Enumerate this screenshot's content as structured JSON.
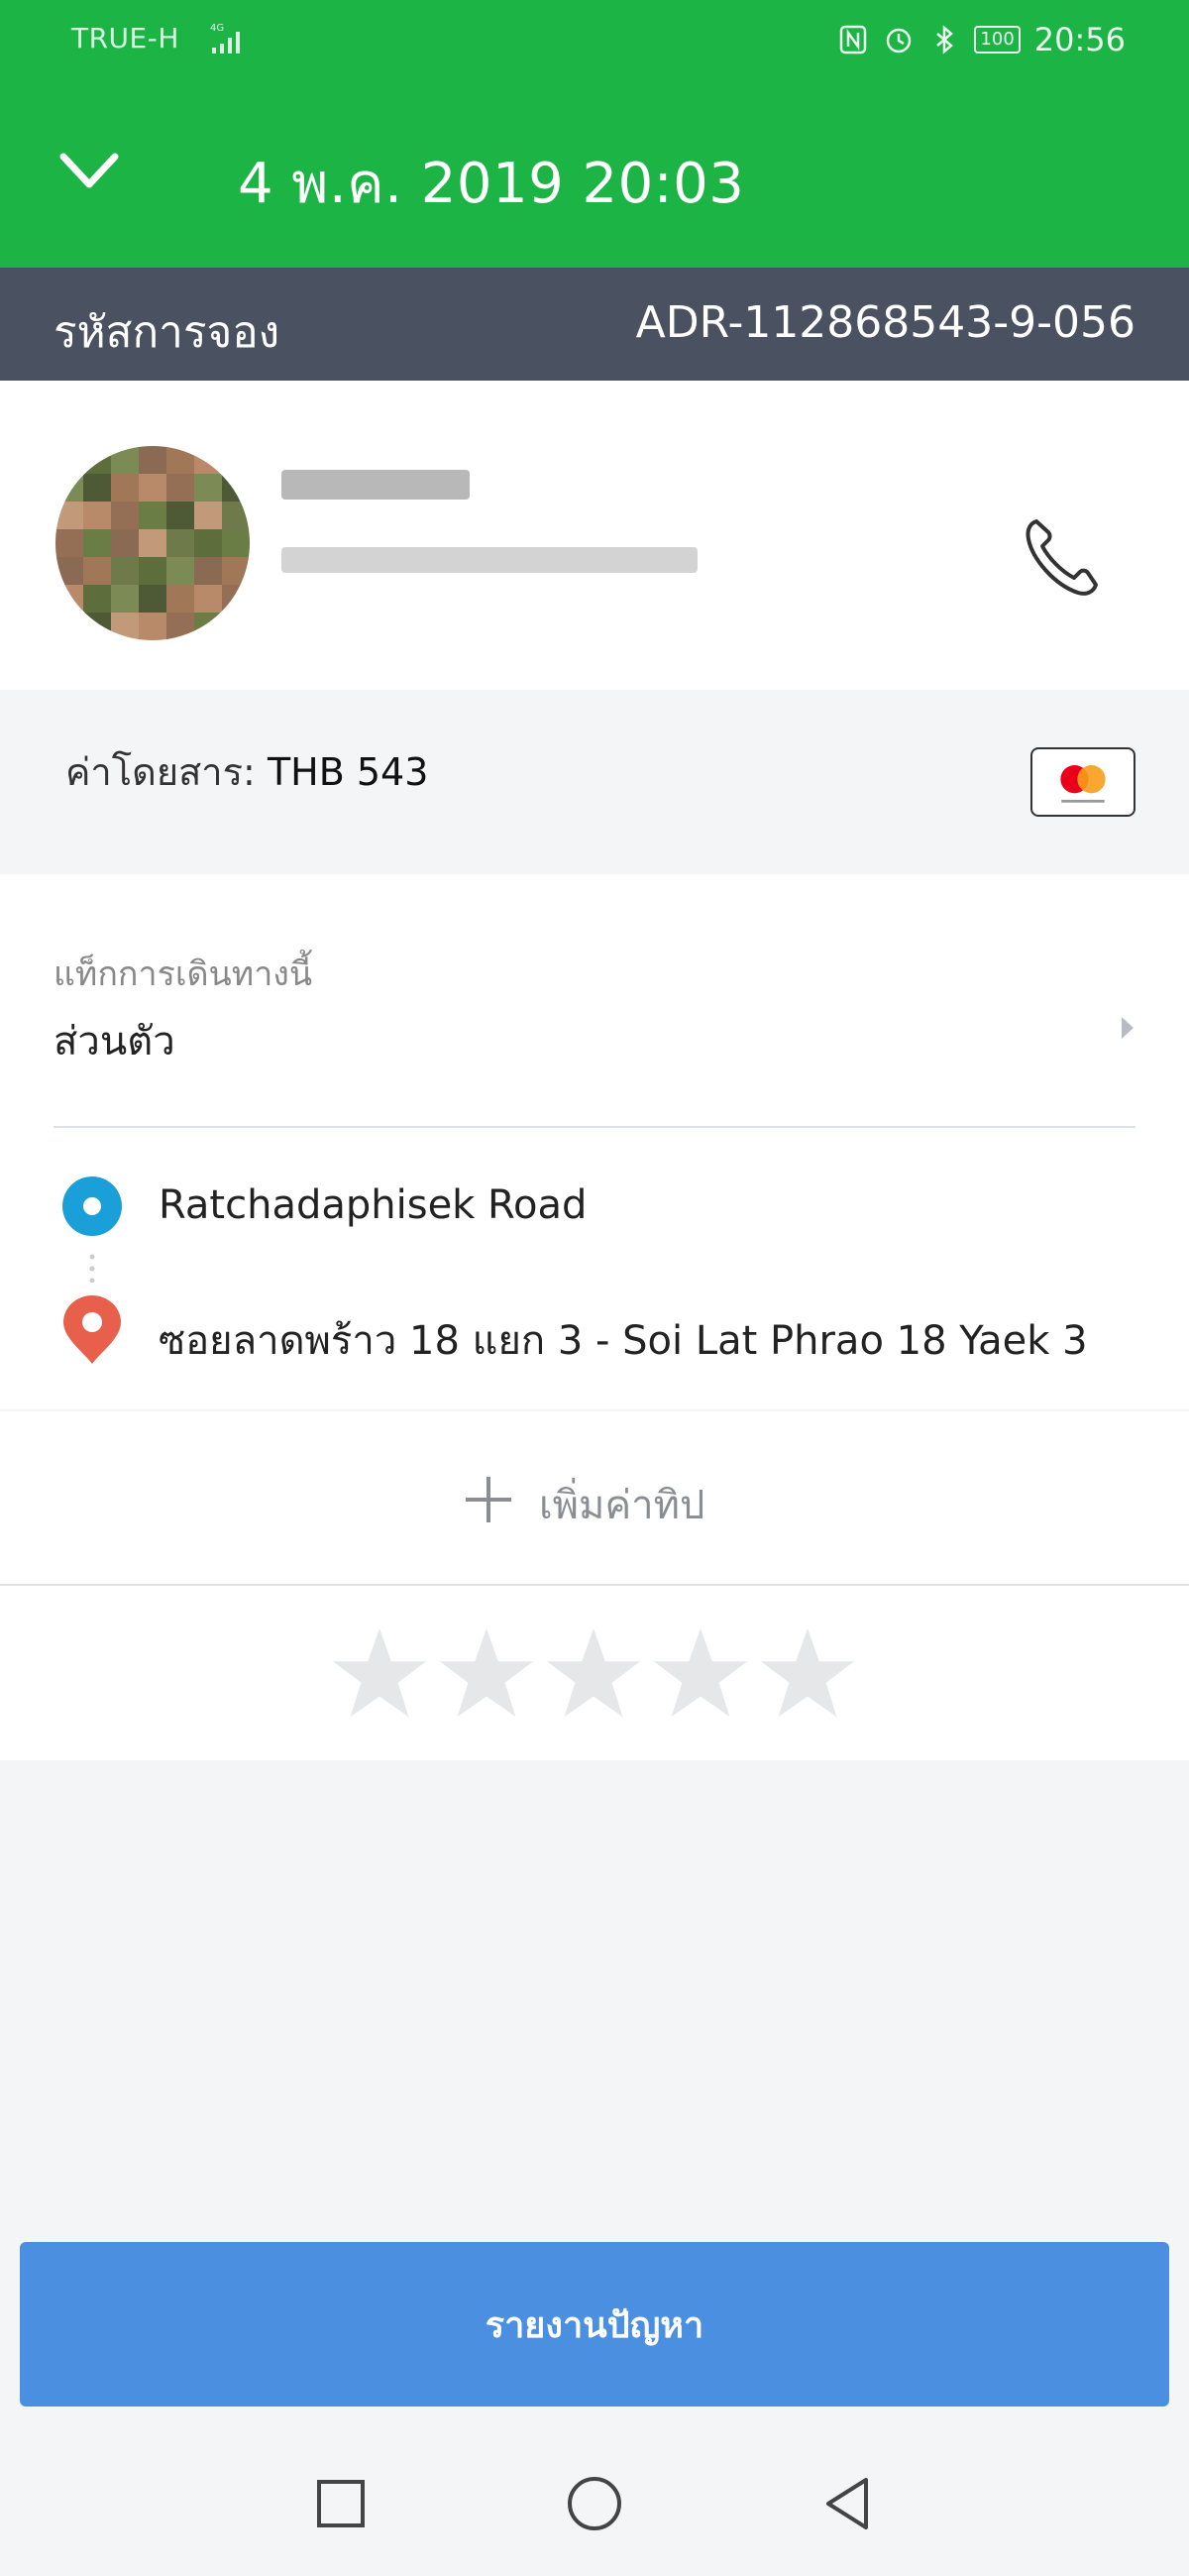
{
  "status_bar": {
    "carrier": "TRUE-H",
    "network": "4G",
    "battery": "100",
    "time": "20:56"
  },
  "header": {
    "title": "4 พ.ค. 2019 20:03"
  },
  "booking": {
    "label": "รหัสการจอง",
    "code": "ADR-112868543-9-056"
  },
  "fare": {
    "label": "ค่าโดยสาร: ",
    "amount": "THB 543",
    "payment_icon": "mastercard-icon"
  },
  "trip_tag": {
    "label": "แท็กการเดินทางนี้",
    "value": "ส่วนตัว"
  },
  "route": {
    "pickup": "Ratchadaphisek Road",
    "dropoff": "ซอยลาดพร้าว 18 แยก 3 - Soi Lat Phrao 18 Yaek 3"
  },
  "tip": {
    "label": "เพิ่มค่าทิป"
  },
  "rating": {
    "stars_total": 5,
    "stars_filled": 0
  },
  "actions": {
    "report_label": "รายงานปัญหา"
  },
  "colors": {
    "brand_green": "#1db446",
    "header_gray": "#4a5261",
    "button_blue": "#4a8fe0",
    "pickup_blue": "#1a9fd8",
    "dropoff_red": "#e8604c"
  }
}
